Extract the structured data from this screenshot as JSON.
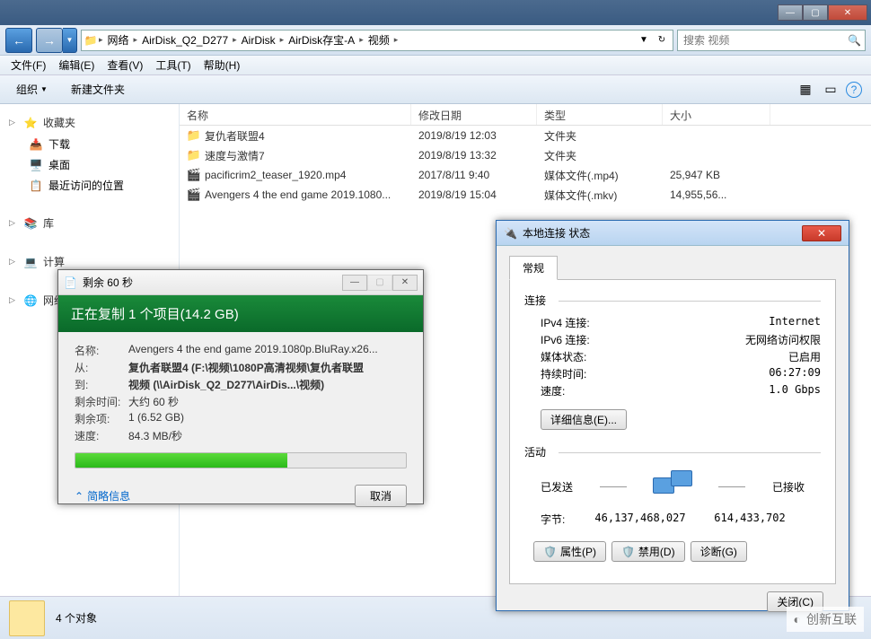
{
  "titlebar": {
    "min": "—",
    "max": "▢",
    "close": "✕"
  },
  "nav": {
    "back": "←",
    "fwd": "→",
    "dropdown": "▼",
    "refresh": "↻",
    "godown": "▼"
  },
  "breadcrumbs": [
    "网络",
    "AirDisk_Q2_D277",
    "AirDisk",
    "AirDisk存宝-A",
    "视频"
  ],
  "search": {
    "placeholder": "搜索 视频",
    "icon": "🔍"
  },
  "menubar": [
    "文件(F)",
    "编辑(E)",
    "查看(V)",
    "工具(T)",
    "帮助(H)"
  ],
  "toolbar": {
    "organize": "组织",
    "newfolder": "新建文件夹",
    "view": "▦",
    "preview": "▭",
    "help": "?"
  },
  "sidebar": {
    "favorites": {
      "title": "收藏夹",
      "items": [
        "下载",
        "桌面",
        "最近访问的位置"
      ]
    },
    "library": {
      "title": "库"
    },
    "computer": {
      "title": "计算"
    },
    "network": {
      "title": "网络"
    }
  },
  "filehead": {
    "name": "名称",
    "date": "修改日期",
    "type": "类型",
    "size": "大小"
  },
  "files": [
    {
      "icon": "📁",
      "name": "复仇者联盟4",
      "date": "2019/8/19 12:03",
      "type": "文件夹",
      "size": ""
    },
    {
      "icon": "📁",
      "name": "速度与激情7",
      "date": "2019/8/19 13:32",
      "type": "文件夹",
      "size": ""
    },
    {
      "icon": "🎬",
      "name": "pacificrim2_teaser_1920.mp4",
      "date": "2017/8/11 9:40",
      "type": "媒体文件(.mp4)",
      "size": "25,947 KB"
    },
    {
      "icon": "🎬",
      "name": "Avengers 4 the end game 2019.1080...",
      "date": "2019/8/19 15:04",
      "type": "媒体文件(.mkv)",
      "size": "14,955,56..."
    }
  ],
  "statustext": "4 个对象",
  "copy": {
    "title": "剩余 60 秒",
    "heading": "正在复制 1 个项目(14.2 GB)",
    "rows": {
      "name_l": "名称:",
      "name_v": "Avengers 4 the end game 2019.1080p.BluRay.x26...",
      "from_l": "从:",
      "from_v": "复仇者联盟4 (F:\\视频\\1080P高清视频\\复仇者联盟",
      "to_l": "到:",
      "to_v": "视频 (\\\\AirDisk_Q2_D277\\AirDis...\\视频)",
      "remain_l": "剩余时间:",
      "remain_v": "大约 60 秒",
      "items_l": "剩余项:",
      "items_v": "1 (6.52 GB)",
      "speed_l": "速度:",
      "speed_v": "84.3 MB/秒"
    },
    "more": "简略信息",
    "cancel": "取消"
  },
  "net": {
    "title": "本地连接 状态",
    "tab": "常规",
    "connect": "连接",
    "rows": {
      "ipv4_l": "IPv4 连接:",
      "ipv4_v": "Internet",
      "ipv6_l": "IPv6 连接:",
      "ipv6_v": "无网络访问权限",
      "media_l": "媒体状态:",
      "media_v": "已启用",
      "dur_l": "持续时间:",
      "dur_v": "06:27:09",
      "speed_l": "速度:",
      "speed_v": "1.0 Gbps"
    },
    "details": "详细信息(E)...",
    "activity": "活动",
    "sent": "已发送",
    "recv": "已接收",
    "bytes_l": "字节:",
    "sent_v": "46,137,468,027",
    "recv_v": "614,433,702",
    "btns": {
      "prop": "属性(P)",
      "disable": "禁用(D)",
      "diag": "诊断(G)"
    },
    "close": "关闭(C)"
  },
  "watermark": "创新互联"
}
